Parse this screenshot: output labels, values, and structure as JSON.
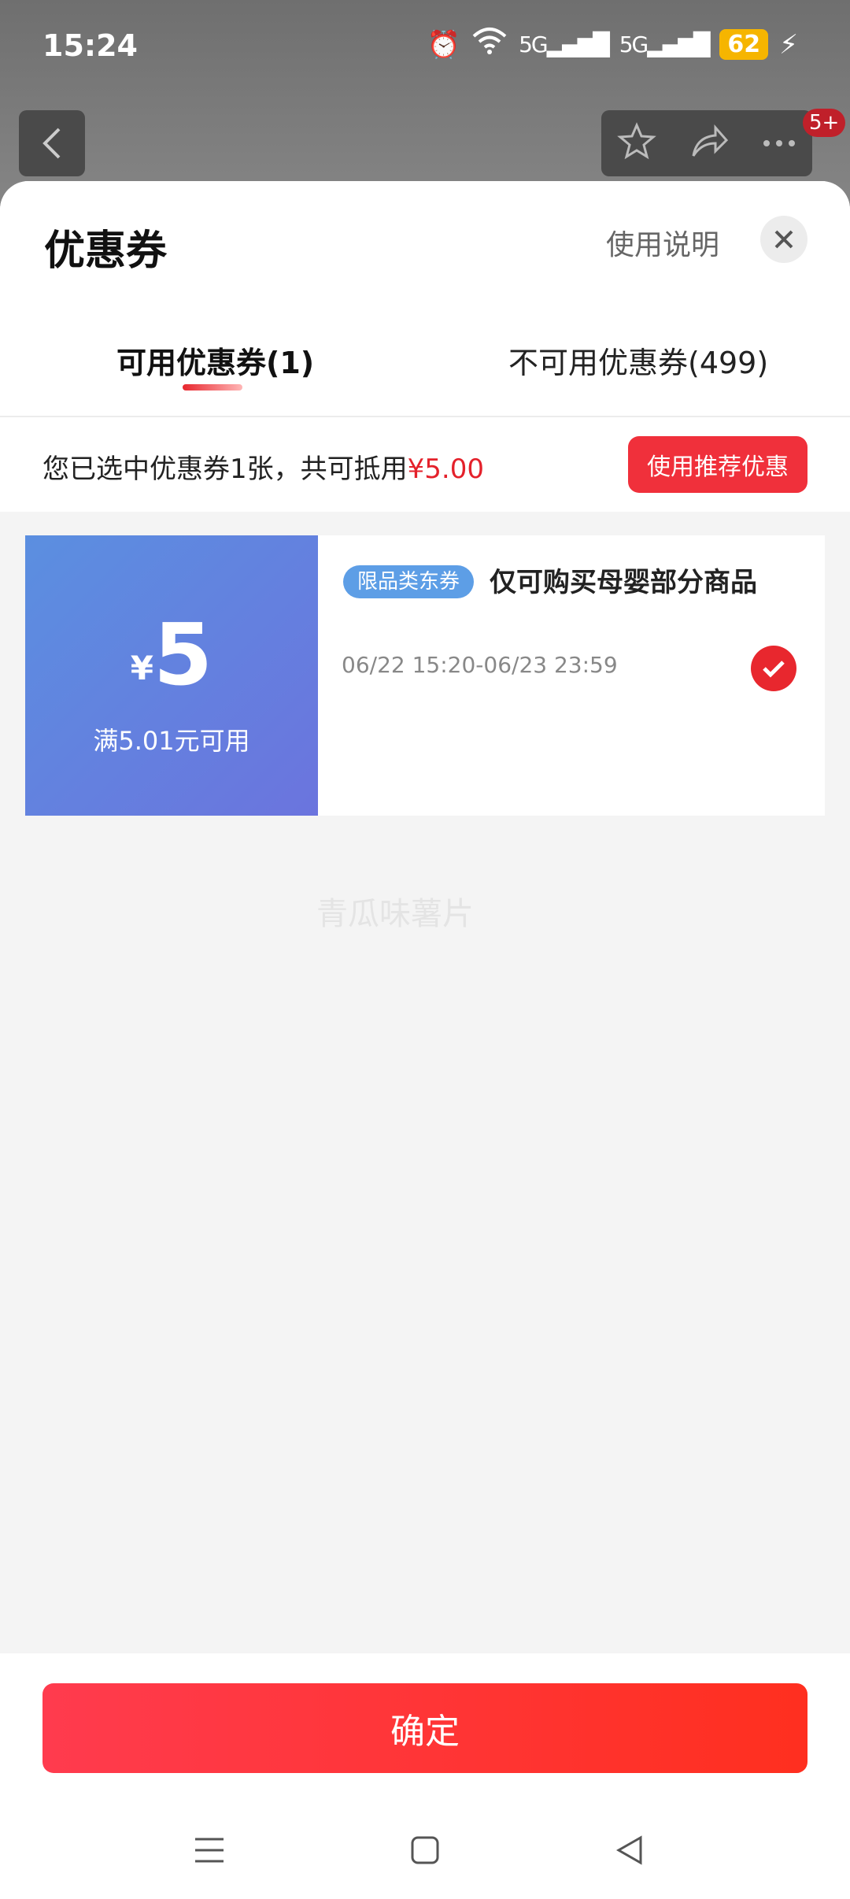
{
  "status": {
    "time": "15:24",
    "battery": "62",
    "signal1": "5G",
    "signal2": "5G"
  },
  "header": {
    "badge": "5+"
  },
  "sheet": {
    "title": "优惠券",
    "help": "使用说明",
    "tabs": [
      {
        "label": "可用优惠券(1)",
        "active": true
      },
      {
        "label": "不可用优惠券(499)",
        "active": false
      }
    ],
    "summary": {
      "prefix": "您已选中优惠券1张，共可抵用",
      "amount": "¥5.00",
      "button": "使用推荐优惠"
    },
    "coupon": {
      "currency": "¥",
      "value": "5",
      "condition": "满5.01元可用",
      "tag": "限品类东券",
      "title": "仅可购买母婴部分商品",
      "date": "06/22 15:20-06/23 23:59",
      "selected": true
    },
    "watermark": "青瓜味薯片",
    "confirm": "确定"
  },
  "colors": {
    "accent": "#e8272e",
    "coupon_blue": "#5b8fe0",
    "tag_blue": "#5d9ee6"
  }
}
